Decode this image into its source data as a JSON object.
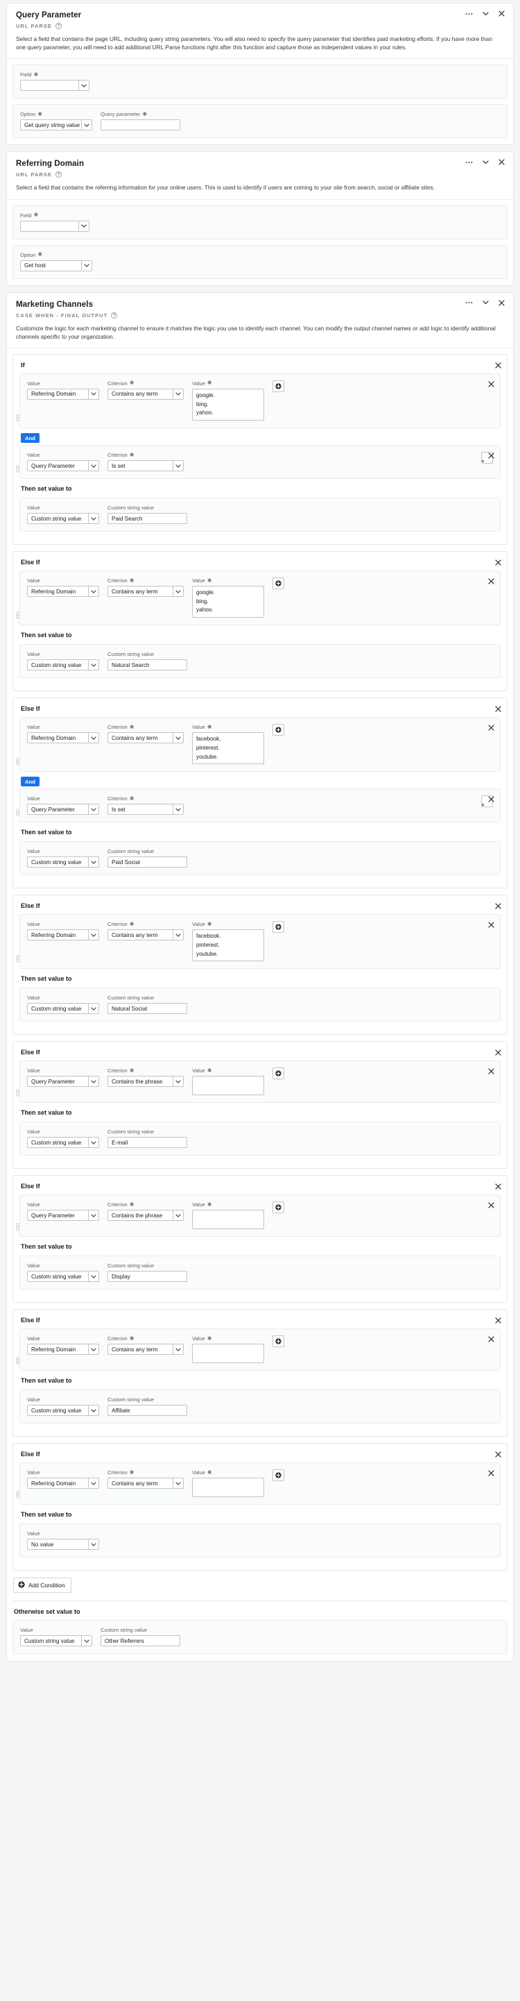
{
  "cards": [
    {
      "title": "Query Parameter",
      "subtype": "URL PARSE",
      "description": "Select a field that contains the page URL, including query string parameters. You will also need to specify the query parameter that identifies paid marketing efforts. If you have more than one query parameter, you will need to add additional URL Parse functions right after this function and capture those as independent values in your rules.",
      "field_label": "Field",
      "field_value": "",
      "option_label": "Option",
      "option_value": "Get query string value",
      "extra_label": "Query parameter",
      "extra_value": ""
    },
    {
      "title": "Referring Domain",
      "subtype": "URL PARSE",
      "description": "Select a field that contains the referring information for your online users. This is used to identify if users are coming to your site from search, social or affiliate sites.",
      "field_label": "Field",
      "field_value": "",
      "option_label": "Option",
      "option_value": "Get host"
    }
  ],
  "marketing": {
    "title": "Marketing Channels",
    "subtype": "CASE WHEN - FINAL OUTPUT",
    "description": "Customize the logic for each marketing channel to ensure it matches the logic you use to identify each channel. You can modify the output channel names or add logic to identify additional channels specific to your organization.",
    "labels": {
      "value": "Value",
      "criterion": "Criterion",
      "custom_string_value": "Custom string value",
      "then_set_value_to": "Then set value to",
      "otherwise_set_value_to": "Otherwise set value to",
      "and": "And",
      "add_condition": "Add Condition"
    },
    "blocks": [
      {
        "title": "If",
        "conditions": [
          {
            "value": "Referring Domain",
            "criterion": "Contains any term",
            "term_value": "google.\nbing.\nyahoo.",
            "has_value": true
          },
          {
            "value": "Query Parameter",
            "criterion": "Is set",
            "term_value": "",
            "has_value": false
          }
        ],
        "then_value": "Custom string value",
        "then_custom": "Paid Search"
      },
      {
        "title": "Else If",
        "conditions": [
          {
            "value": "Referring Domain",
            "criterion": "Contains any term",
            "term_value": "google.\nbing.\nyahoo.",
            "has_value": true
          }
        ],
        "then_value": "Custom string value",
        "then_custom": "Natural Search"
      },
      {
        "title": "Else If",
        "conditions": [
          {
            "value": "Referring Domain",
            "criterion": "Contains any term",
            "term_value": "facebook.\npinterest.\nyoutube.",
            "has_value": true
          },
          {
            "value": "Query Parameter",
            "criterion": "Is set",
            "term_value": "",
            "has_value": false
          }
        ],
        "then_value": "Custom string value",
        "then_custom": "Paid Social"
      },
      {
        "title": "Else If",
        "conditions": [
          {
            "value": "Referring Domain",
            "criterion": "Contains any term",
            "term_value": "facebook.\npinterest.\nyoutube.",
            "has_value": true
          }
        ],
        "then_value": "Custom string value",
        "then_custom": "Natural Social"
      },
      {
        "title": "Else If",
        "conditions": [
          {
            "value": "Query Parameter",
            "criterion": "Contains the phrase",
            "term_value": "",
            "has_value": true
          }
        ],
        "then_value": "Custom string value",
        "then_custom": "E-mail"
      },
      {
        "title": "Else If",
        "conditions": [
          {
            "value": "Query Parameter",
            "criterion": "Contains the phrase",
            "term_value": "",
            "has_value": true
          }
        ],
        "then_value": "Custom string value",
        "then_custom": "Display"
      },
      {
        "title": "Else If",
        "conditions": [
          {
            "value": "Referring Domain",
            "criterion": "Contains any term",
            "term_value": "",
            "has_value": true
          }
        ],
        "then_value": "Custom string value",
        "then_custom": "Affiliate"
      },
      {
        "title": "Else If",
        "conditions": [
          {
            "value": "Referring Domain",
            "criterion": "Contains any term",
            "term_value": "",
            "has_value": true
          }
        ],
        "then_value": "No value",
        "then_custom": null
      }
    ],
    "otherwise_value": "Custom string value",
    "otherwise_custom": "Other Referrers"
  },
  "icons": {
    "more": "more-horizontal-icon",
    "collapse": "chevron-down-icon",
    "close": "close-icon",
    "help": "?"
  },
  "colors": {
    "accent": "#1a73e8",
    "border": "#e3e5e8",
    "page_bg": "#f4f5f6"
  }
}
